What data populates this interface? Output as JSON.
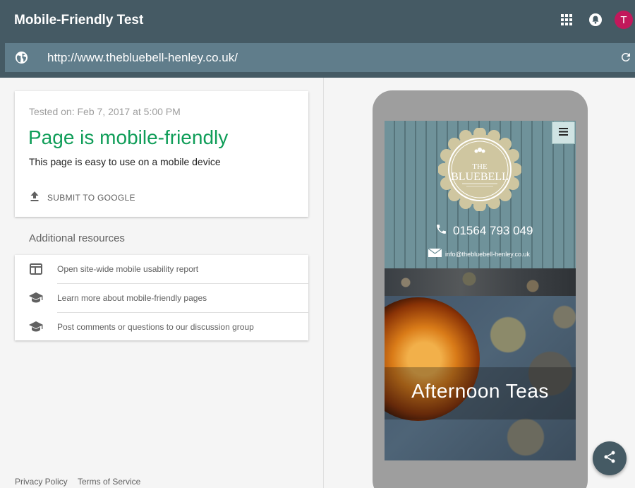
{
  "header": {
    "title": "Mobile-Friendly Test",
    "avatar_letter": "T",
    "icons": [
      "apps-icon",
      "notifications-icon"
    ]
  },
  "urlbar": {
    "value": "http://www.thebluebell-henley.co.uk/",
    "icons": [
      "globe-icon",
      "refresh-icon"
    ]
  },
  "result": {
    "tested_on": "Tested on: Feb 7, 2017 at 5:00 PM",
    "title": "Page is mobile-friendly",
    "description": "This page is easy to use on a mobile device",
    "submit_label": "SUBMIT TO GOOGLE"
  },
  "resources": {
    "title": "Additional resources",
    "items": [
      {
        "label": "Open site-wide mobile usability report",
        "icon": "web-page-icon"
      },
      {
        "label": "Learn more about mobile-friendly pages",
        "icon": "school-icon"
      },
      {
        "label": "Post comments or questions to our discussion group",
        "icon": "school-icon"
      }
    ]
  },
  "footer": {
    "privacy": "Privacy Policy",
    "terms": "Terms of Service"
  },
  "preview": {
    "phone_number": "01564 793 049",
    "email": "info@thebluebell-henley.co.uk",
    "banner_title": "Afternoon Teas",
    "logo_top": "THE",
    "logo_main": "BLUEBELL"
  },
  "colors": {
    "header": "#455a64",
    "urlbar": "#607d8b",
    "success": "#0f9d58",
    "avatar": "#c2185b"
  }
}
